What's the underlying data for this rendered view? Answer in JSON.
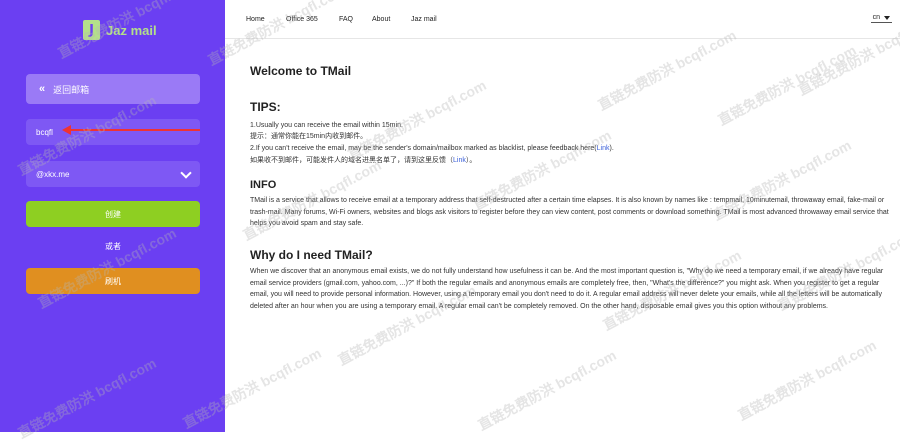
{
  "sidebar": {
    "logo_glyph": "J",
    "logo_text": "Jaz mail",
    "back_label": "返回邮箱",
    "back_icon": "double-chevron-left-icon",
    "email_value": "bcqfl",
    "domain_value": "@xkx.me",
    "create_label": "创建",
    "or_label": "或者",
    "refresh_label": "刷机"
  },
  "nav": {
    "items": [
      "Home",
      "Office 365",
      "FAQ",
      "About",
      "Jaz mail"
    ],
    "lang": "cn"
  },
  "main": {
    "title": "Welcome to TMail",
    "tips_heading": "TIPS:",
    "tip1": "1.Usually you can receive the email within 15min.",
    "tip1_cn": "提示：通常你能在15min内收到邮件。",
    "tip2_pre": "2.If you can't receive the email, may be the sender's domain/mailbox marked as blacklist, please feedback here(",
    "tip2_link": "Link",
    "tip2_post": ").",
    "tip2_cn_pre": "如果收不到邮件，可能发件人的域名进黑名单了，请到这里反馈（",
    "tip2_cn_link": "Link",
    "tip2_cn_post": "）。",
    "info_heading": "INFO",
    "info_text": "TMail is a service that allows to receive email at a temporary address that self-destructed after a certain time elapses. It is also known by names like : tempmail, 10minutemail, throwaway email, fake-mail or trash-mail. Many forums, Wi-Fi owners, websites and blogs ask visitors to register before they can view content, post comments or download something. TMail is most advanced throwaway email service that helps you avoid spam and stay safe.",
    "why_heading": "Why do I need TMail?",
    "why_text": "When we discover that an anonymous email exists, we do not fully understand how usefulness it can be. And the most important question is, \"Why do we need a temporary email, if we already have regular email service providers (gmail.com, yahoo.com, ...)?\" If both the regular emails and anonymous emails are completely free, then, \"What's the difference?\" you might ask. When you register to get a regular email, you will need to provide personal information. However, using a temporary email you don't need to do it. A regular email address will never delete your emails, while all the letters will be automatically deleted after an hour when you are using a temporary email. A regular email can't be completely removed. On the other hand, disposable email gives you this option without any problems."
  },
  "watermark": "直链免费防洪 bcqfl.com",
  "colors": {
    "sidebar_bg": "#6b3ff2",
    "create_btn": "#8ecf22",
    "refresh_btn": "#e08f20",
    "logo_accent": "#b4e08a",
    "link": "#3a5fd9"
  }
}
